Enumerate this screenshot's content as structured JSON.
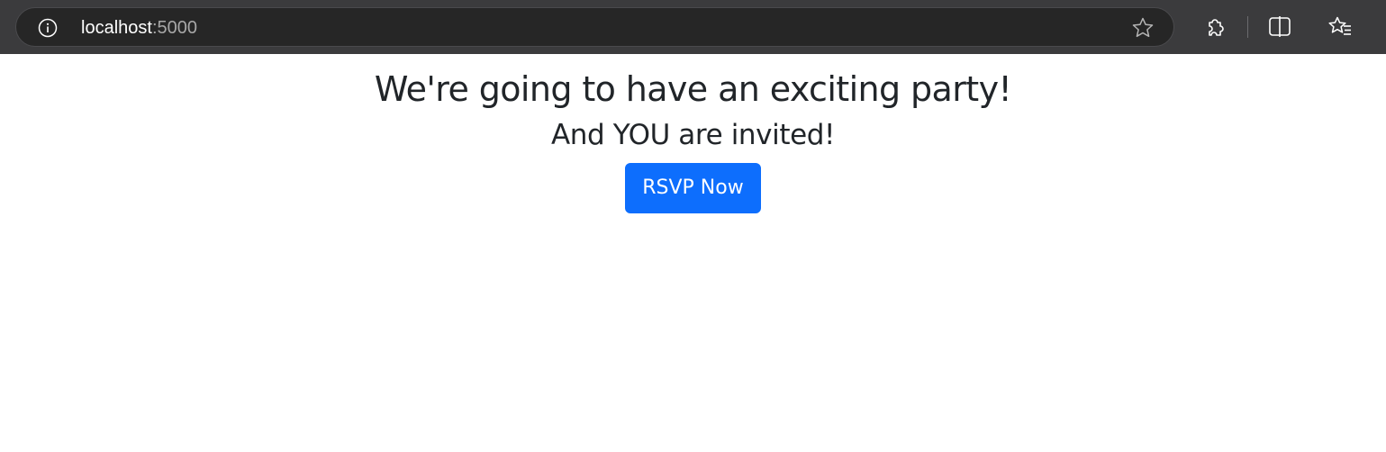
{
  "browser": {
    "url_host": "localhost",
    "url_port": ":5000",
    "icons": {
      "info": "info-icon",
      "favorite": "star-icon",
      "extensions": "puzzle-icon",
      "split_screen": "split-screen-icon",
      "favorites_list": "favorites-icon"
    },
    "colors": {
      "toolbar_bg": "#3b3b3d",
      "address_bg": "#262626"
    }
  },
  "page": {
    "heading": "We're going to have an exciting party!",
    "subheading": "And YOU are invited!",
    "rsvp_label": "RSVP Now",
    "colors": {
      "text": "#212529",
      "button_bg": "#0d6efd",
      "button_text": "#ffffff"
    }
  }
}
